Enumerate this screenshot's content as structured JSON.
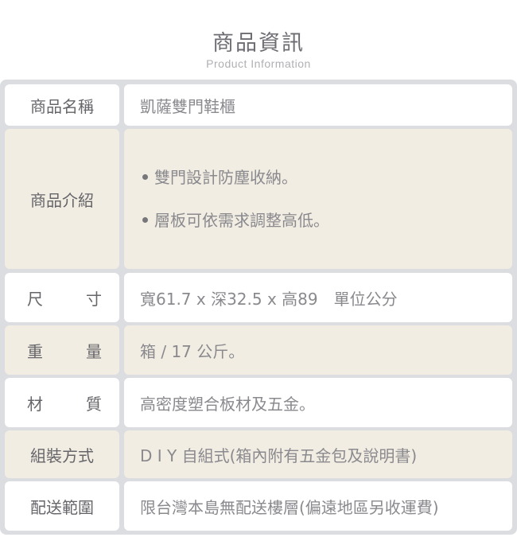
{
  "header": {
    "title": "商品資訊",
    "subtitle": "Product Information"
  },
  "rows": [
    {
      "label": "商品名稱",
      "label_chars": null,
      "value": "凱薩雙門鞋櫃"
    },
    {
      "label": "商品介紹",
      "label_chars": null,
      "bullets": [
        "雙門設計防塵收納。",
        "層板可依需求調整高低。"
      ]
    },
    {
      "label": "尺寸",
      "label_chars": [
        "尺",
        "寸"
      ],
      "value": "寬61.7 x 深32.5 x 高89　單位公分"
    },
    {
      "label": "重量",
      "label_chars": [
        "重",
        "量"
      ],
      "value": "箱 / 17 公斤。"
    },
    {
      "label": "材質",
      "label_chars": [
        "材",
        "質"
      ],
      "value": "高密度塑合板材及五金。"
    },
    {
      "label": "組裝方式",
      "label_chars": null,
      "value": "D I Y 自組式(箱內附有五金包及說明書)"
    },
    {
      "label": "配送範圍",
      "label_chars": null,
      "value": "限台灣本島無配送樓層(偏遠地區另收運費)"
    }
  ],
  "colors": {
    "frame": "#dcdde0",
    "row_white": "#ffffff",
    "row_beige": "#f1ede3",
    "label_text": "#66656a",
    "value_text": "#8a898e"
  }
}
